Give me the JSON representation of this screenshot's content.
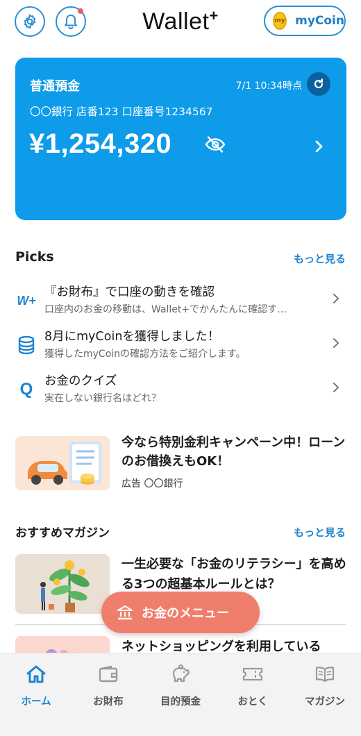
{
  "header": {
    "title": "Wallet",
    "title_sup": "+",
    "coin_badge": "my",
    "mycoin_label": "myCoin",
    "notification_dot_color": "#ef5a6f"
  },
  "account": {
    "type": "普通預金",
    "as_of": "7/1 10:34時点",
    "info": "〇〇銀行 店番123 口座番号1234567",
    "balance": "¥1,254,320"
  },
  "picks": {
    "title": "Picks",
    "more": "もっと見る",
    "items": [
      {
        "icon": "wallet-plus-logo-icon",
        "icon_text": "W+",
        "title": "『お財布』で口座の動きを確認",
        "subtitle": "口座内のお金の移動は、Wallet+でかんたんに確認す…"
      },
      {
        "icon": "coin-stack-icon",
        "title": "8月にmyCoinを獲得しました！",
        "subtitle": "獲得したmyCoinの確認方法をご紹介します。"
      },
      {
        "icon": "quiz-icon",
        "icon_text": "Q",
        "title": "お金のクイズ",
        "subtitle": "実在しない銀行名はどれ？"
      }
    ]
  },
  "ad": {
    "text": "今なら特別金利キャンペーン中！ローンのお借換えもOK！",
    "sponsor": "広告 〇〇銀行"
  },
  "magazine": {
    "title": "おすすめマガジン",
    "more": "もっと見る",
    "items": [
      {
        "title": "一生必要な「お金のリテラシー」を高める3つの超基本ルールとは？"
      },
      {
        "title": "ネットショッピングを利用している"
      }
    ]
  },
  "fab": {
    "label": "お金のメニュー"
  },
  "nav": {
    "items": [
      {
        "label": "ホーム",
        "icon": "home-icon",
        "active": true
      },
      {
        "label": "お財布",
        "icon": "wallet-icon",
        "active": false
      },
      {
        "label": "目的預金",
        "icon": "piggy-bank-icon",
        "active": false
      },
      {
        "label": "おとく",
        "icon": "ticket-icon",
        "active": false
      },
      {
        "label": "マガジン",
        "icon": "book-icon",
        "active": false
      }
    ]
  },
  "colors": {
    "brand_blue": "#2b8fd6",
    "card_blue": "#0d9bea",
    "link_blue": "#1e84cf",
    "fab_coral": "#f07e6c"
  }
}
